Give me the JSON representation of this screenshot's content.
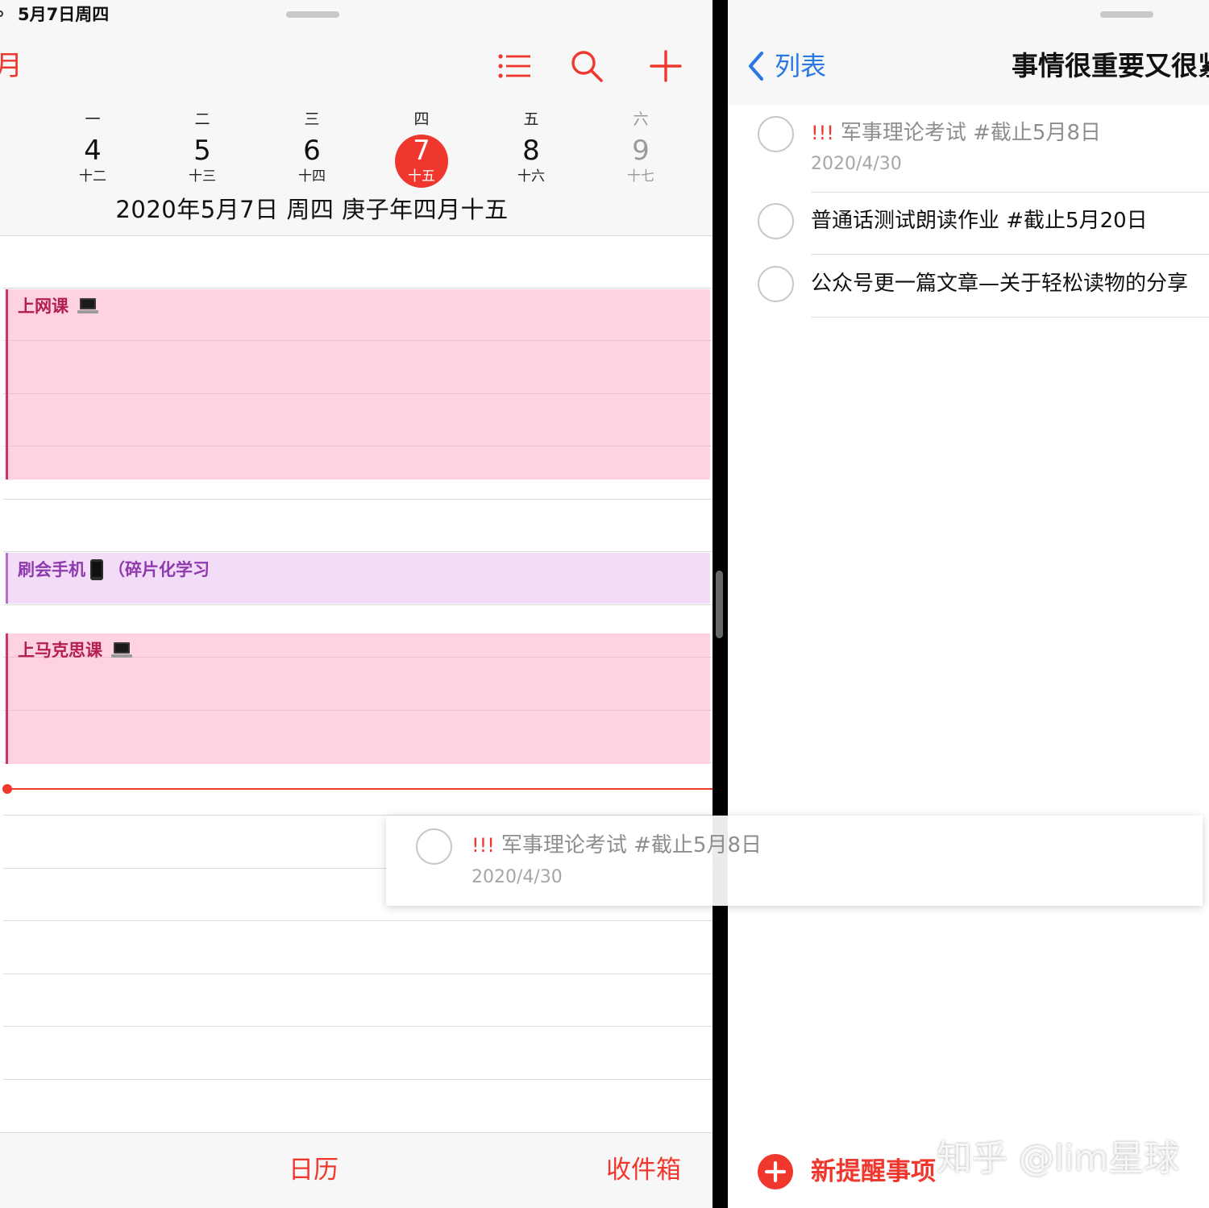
{
  "status_bar": {
    "date": "5月7日周四"
  },
  "calendar": {
    "back_fragment": "月",
    "toolbar": {
      "list": "list-icon",
      "search": "search-icon",
      "add": "add-icon"
    },
    "week": [
      {
        "weekday": "一",
        "day": "4",
        "lunar": "十二"
      },
      {
        "weekday": "二",
        "day": "5",
        "lunar": "十三"
      },
      {
        "weekday": "三",
        "day": "6",
        "lunar": "十四"
      },
      {
        "weekday": "四",
        "day": "7",
        "lunar": "十五"
      },
      {
        "weekday": "五",
        "day": "8",
        "lunar": "十六"
      },
      {
        "weekday": "六",
        "day": "9",
        "lunar": "十七"
      }
    ],
    "full_date": "2020年5月7日 周四  庚子年四月十五",
    "events": [
      {
        "title": "上网课"
      },
      {
        "title": "刷会手机",
        "suffix": "（碎片化学习"
      },
      {
        "title": "上马克思课"
      }
    ],
    "tabs": {
      "calendar": "日历",
      "inbox": "收件箱"
    },
    "accent": "#f0372e"
  },
  "reminders": {
    "back_label": "列表",
    "list_title": "事情很重要又很紧",
    "items": [
      {
        "priority": "!!!",
        "title": "军事理论考试 #截止5月8日",
        "date": "2020/4/30"
      },
      {
        "title": "普通话测试朗读作业 #截止5月20日"
      },
      {
        "title": "公众号更一篇文章—关于轻松读物的分享"
      }
    ],
    "new_label": "新提醒事项"
  },
  "drag_card": {
    "priority": "!!!",
    "title": "军事理论考试 #截止5月8日",
    "date": "2020/4/30"
  },
  "watermark": "知乎 @lim星球"
}
